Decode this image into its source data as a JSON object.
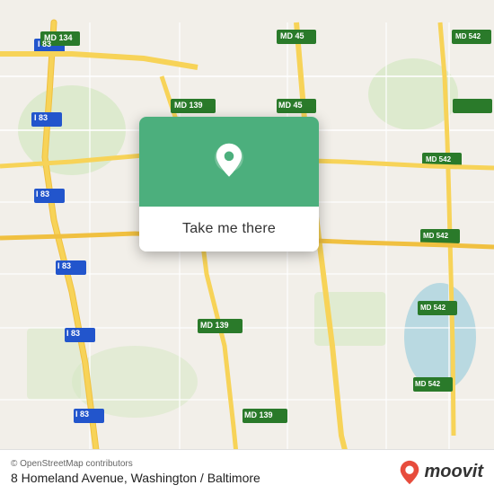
{
  "map": {
    "attribution": "© OpenStreetMap contributors",
    "background_color": "#f2efe9",
    "road_color_major": "#f7d358",
    "road_color_highway": "#f7d358",
    "road_color_minor": "#ffffff",
    "water_color": "#aad3df",
    "green_color": "#c8e6c0"
  },
  "popup": {
    "background_color": "#4caf7d",
    "button_label": "Take me there",
    "pin_color": "#ffffff"
  },
  "bottom_bar": {
    "attribution": "© OpenStreetMap contributors",
    "address": "8 Homeland Avenue, Washington / Baltimore"
  },
  "moovit": {
    "logo_text": "moovit",
    "pin_color_top": "#e74c3c",
    "pin_color_bottom": "#c0392b"
  }
}
